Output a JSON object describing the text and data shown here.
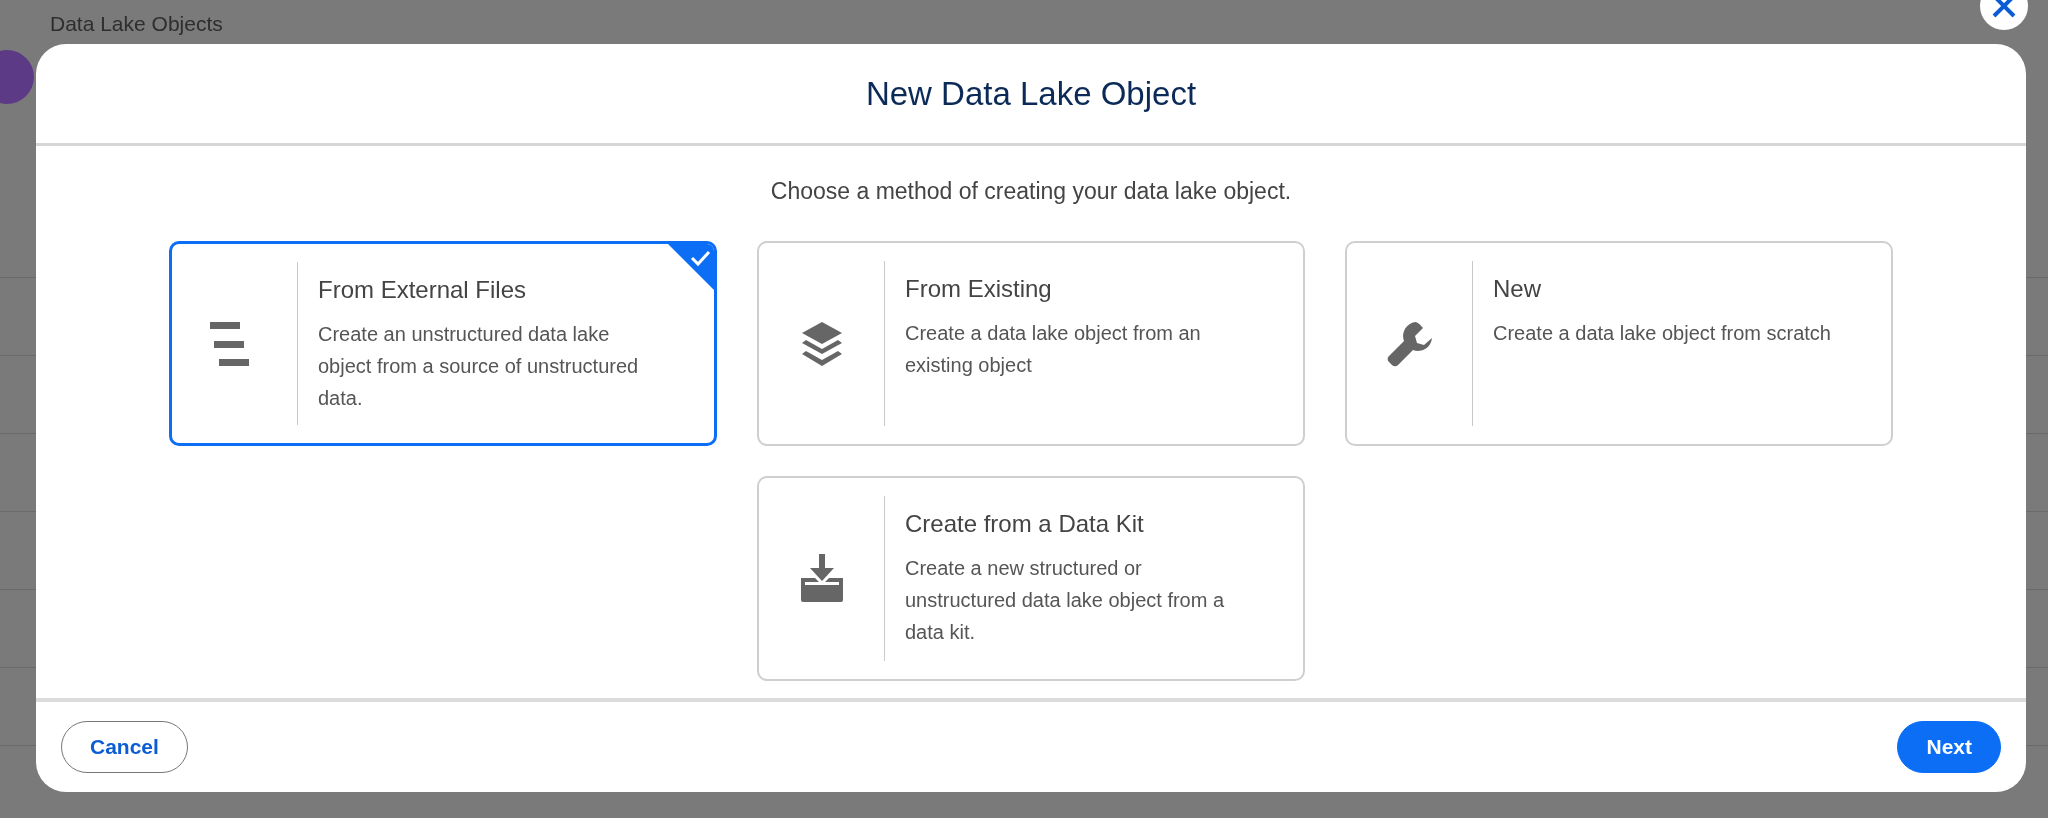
{
  "background": {
    "title": "Data Lake Objects"
  },
  "modal": {
    "title": "New Data Lake Object",
    "subtitle": "Choose a method of creating your data lake object.",
    "options": [
      {
        "kind": "files",
        "title": "From External Files",
        "description": "Create an unstructured data lake object from a source of unstructured data.",
        "selected": true
      },
      {
        "kind": "layers",
        "title": "From Existing",
        "description": "Create a data lake object from an existing object",
        "selected": false
      },
      {
        "kind": "wrench",
        "title": "New",
        "description": "Create a data lake object from scratch",
        "selected": false
      },
      {
        "kind": "kit",
        "title": "Create from a Data Kit",
        "description": "Create a new structured or unstructured data lake object from a data kit.",
        "selected": false
      }
    ],
    "buttons": [
      {
        "kind": "secondary",
        "label": "Cancel"
      },
      {
        "kind": "primary",
        "label": "Next"
      }
    ]
  }
}
